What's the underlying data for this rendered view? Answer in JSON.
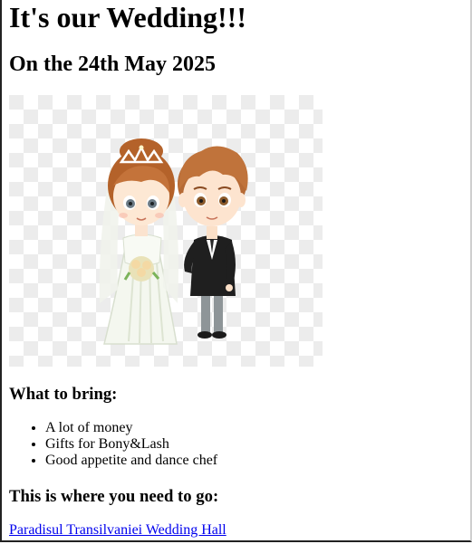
{
  "page": {
    "title": "It's our Wedding!!!",
    "date_heading": "On the 24th May 2025"
  },
  "image": {
    "icon": "bride-and-groom-cartoon"
  },
  "bring": {
    "heading": "What to bring:",
    "items": [
      "A lot of money",
      "Gifts for Bony&Lash",
      "Good appetite and dance chef"
    ]
  },
  "directions": {
    "heading": "This is where you need to go:",
    "link_text": "Paradisul Transilvaniei Wedding Hall"
  },
  "colors": {
    "link": "#0000ee",
    "checker_light": "#ffffff",
    "checker_dark": "#ececec"
  }
}
